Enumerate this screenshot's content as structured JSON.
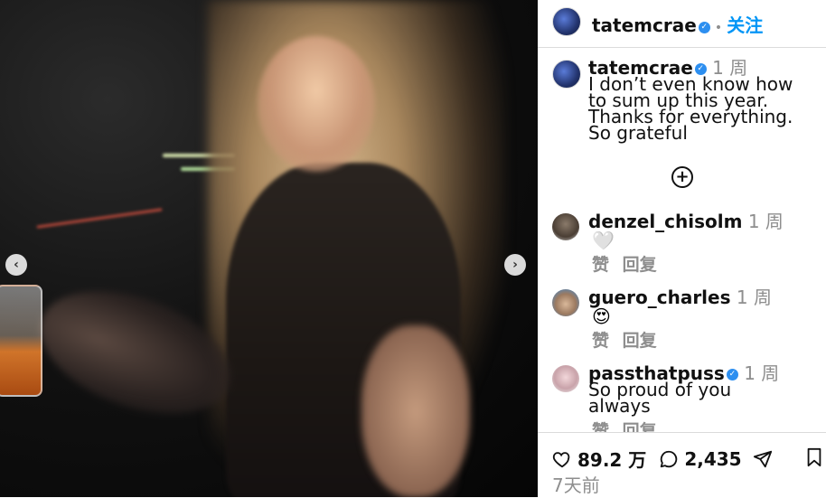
{
  "post": {
    "author": "tatemcrae",
    "follow_label": "关注",
    "caption_time": "1 周",
    "caption_lines": [
      "I don’t even know how",
      "to sum up this year.",
      "Thanks for everything.",
      "So grateful"
    ],
    "likes_count": "89.2 万",
    "comments_count": "2,435",
    "posted_ago": "7天前"
  },
  "comments": [
    {
      "user": "denzel_chisolm",
      "time": "1 周",
      "text": "🤍",
      "like_label": "赞",
      "reply_label": "回复"
    },
    {
      "user": "guero_charles",
      "time": "1 周",
      "text": "😍",
      "like_label": "赞",
      "reply_label": "回复"
    },
    {
      "user": "passthatpuss",
      "time": "1 周",
      "text_lines": [
        "So proud of you",
        "always"
      ],
      "like_label": "赞",
      "reply_label": "回复"
    }
  ],
  "icons": {
    "verified": "verified-badge-icon",
    "load_more": "plus-circle-icon",
    "like": "heart-icon",
    "comment": "speech-bubble-icon",
    "share": "paper-plane-icon",
    "save": "bookmark-icon",
    "prev": "chevron-left-icon",
    "next": "chevron-right-icon"
  },
  "colors": {
    "verified": "#2d8ff0",
    "follow": "#0095f6",
    "muted": "#8e8e8e"
  }
}
